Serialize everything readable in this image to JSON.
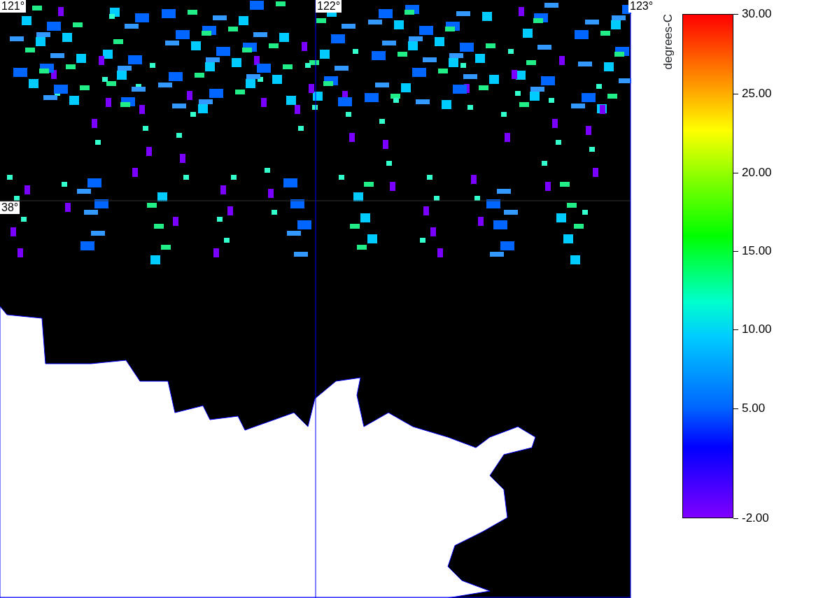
{
  "map": {
    "lon_labels": [
      "121°",
      "122°",
      "123°"
    ],
    "lat_labels": [
      "38°"
    ]
  },
  "legend": {
    "unit": "degrees-C",
    "ticks": [
      "30.00",
      "25.00",
      "20.00",
      "15.00",
      "10.00",
      "5.00",
      "-2.00"
    ]
  }
}
